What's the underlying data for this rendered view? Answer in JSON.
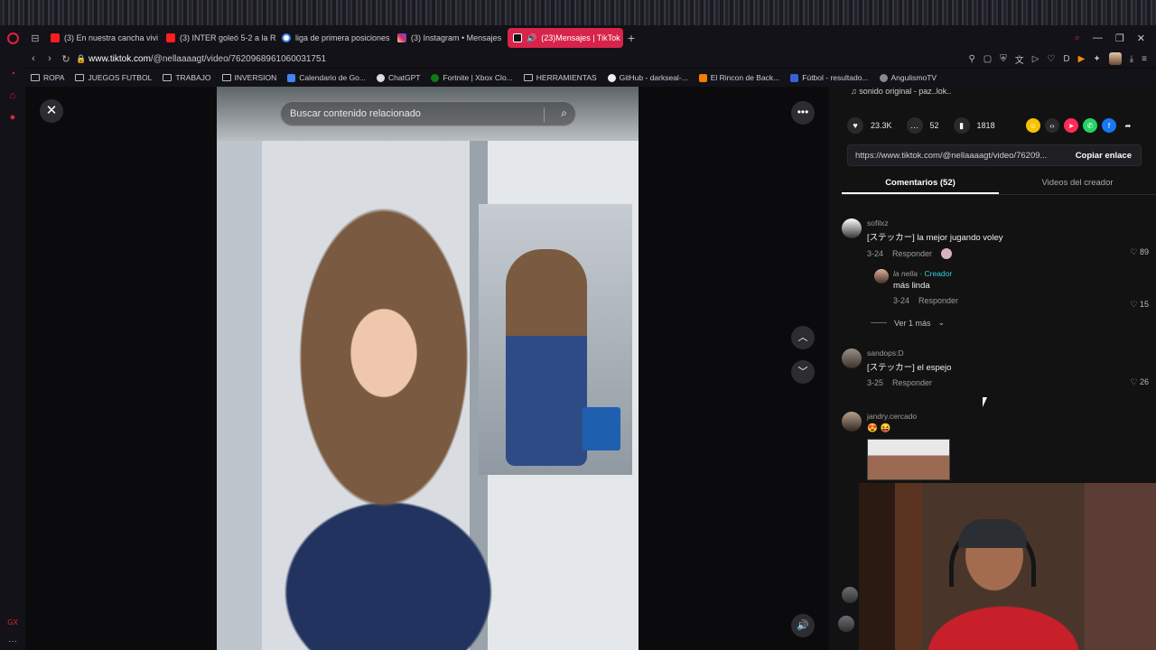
{
  "browser": {
    "tabs": [
      {
        "label": "(3) En nuestra cancha vivi",
        "favicon": "youtube"
      },
      {
        "label": "(3) INTER goleó 5-2 a la R",
        "favicon": "youtube"
      },
      {
        "label": "liga de primera posiciones",
        "favicon": "google"
      },
      {
        "label": "(3) Instagram • Mensajes",
        "favicon": "instagram"
      },
      {
        "label": "(23)Mensajes | TikTok",
        "favicon": "tiktok",
        "active": true
      }
    ],
    "url_prefix": "www.tiktok.com",
    "url_path": "/@nellaaaagt/video/7620968961060031751",
    "bookmarks": [
      {
        "label": "ROPA",
        "icon": "folder-icon"
      },
      {
        "label": "JUEGOS FUTBOL",
        "icon": "folder-icon"
      },
      {
        "label": "TRABAJO",
        "icon": "folder-icon"
      },
      {
        "label": "INVERSION",
        "icon": "folder-icon"
      },
      {
        "label": "Calendario de Go...",
        "icon": "calendar-icon"
      },
      {
        "label": "ChatGPT",
        "icon": "chatgpt-icon"
      },
      {
        "label": "Fortnite | Xbox Clo...",
        "icon": "xbox-icon"
      },
      {
        "label": "HERRAMIENTAS",
        "icon": "folder-icon"
      },
      {
        "label": "GitHub - darkseal-...",
        "icon": "github-icon"
      },
      {
        "label": "El Rincon de Back...",
        "icon": "blogger-icon"
      },
      {
        "label": "Fútbol - resultado...",
        "icon": "football-icon"
      },
      {
        "label": "AngulismoTV",
        "icon": "globe-icon"
      }
    ],
    "sidebar_bottom": "GX"
  },
  "video": {
    "search_placeholder": "Buscar contenido relacionado"
  },
  "panel": {
    "sound": "♫ sonido original - paz..lok..",
    "likes": "23.3K",
    "comments": "52",
    "saves": "1818",
    "link": "https://www.tiktok.com/@nellaaaagt/video/76209...",
    "copy_label": "Copiar enlace",
    "tab_comments": "Comentarios (52)",
    "tab_videos": "Videos del creador",
    "comment_list": [
      {
        "user": "sofilxz",
        "text": "[ステッカー] la mejor jugando voley",
        "date": "3-24",
        "reply": "Responder",
        "likes": "89"
      },
      {
        "user": "la nella",
        "badge": "· Creador",
        "text": "más linda",
        "date": "3-24",
        "reply": "Responder",
        "likes": "15"
      },
      {
        "user": "sandops:D",
        "text": "[ステッカー] el espejo",
        "date": "3-25",
        "reply": "Responder",
        "likes": "26"
      },
      {
        "user": "jandry.cercado",
        "text": "😍 😝"
      }
    ],
    "see_more": "Ver 1 más"
  }
}
